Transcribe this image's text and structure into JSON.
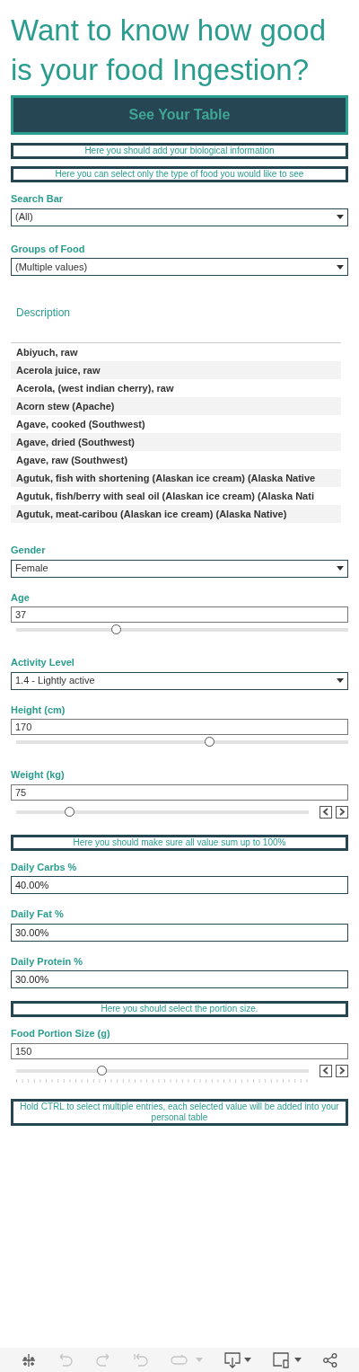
{
  "title": "Want to know how good is your food Ingestion?",
  "table_button": {
    "label": "See Your Table"
  },
  "banner_bio": "Here you should add your biological information",
  "banner_food": "Here you can select only the type of food you would like to see",
  "filters": [
    {
      "label": "Search Bar",
      "value": "(All)"
    },
    {
      "label": "Groups of Food",
      "value": "(Multiple values)"
    }
  ],
  "description_list": {
    "header": "Description",
    "items": [
      {
        "label": "Abiyuch, raw"
      },
      {
        "label": "Acerola juice, raw"
      },
      {
        "label": "Acerola, (west indian cherry), raw"
      },
      {
        "label": "Acorn stew (Apache)"
      },
      {
        "label": "Agave, cooked (Southwest)"
      },
      {
        "label": "Agave, dried (Southwest)"
      },
      {
        "label": "Agave, raw (Southwest)"
      },
      {
        "label": "Agutuk, fish with shortening (Alaskan ice cream) (Alaska Native"
      },
      {
        "label": "Agutuk, fish/berry with seal oil (Alaskan ice cream) (Alaska Nati"
      },
      {
        "label": "Agutuk, meat-caribou (Alaskan ice cream) (Alaska Native)"
      }
    ]
  },
  "bio_fields": [
    {
      "kind": "dropdown",
      "label": "Gender",
      "value": "Female"
    },
    {
      "kind": "slider",
      "label": "Age",
      "value": "37",
      "level": 0.3,
      "steppers": false
    },
    {
      "kind": "dropdown",
      "label": "Activity Level",
      "value": "1.4 - Lightly active"
    },
    {
      "kind": "slider",
      "label": "Height (cm)",
      "value": "170",
      "level": 0.58,
      "steppers": false
    },
    {
      "kind": "slider",
      "label": "Weight (kg)",
      "value": "75",
      "level": 0.18,
      "steppers": true
    }
  ],
  "banner_sum": "Here you should  make sure all value sum up to 100%",
  "macro_fields": [
    {
      "label": "Daily Carbs %",
      "value": "40.00%"
    },
    {
      "label": "Daily Fat %",
      "value": "30.00%"
    },
    {
      "label": "Daily Protein %",
      "value": "30.00%"
    }
  ],
  "banner_portion": "Here you should select the portion size.",
  "portion": {
    "label": "Food Portion Size (g)",
    "value": "150",
    "level": 0.29,
    "steppers": true
  },
  "banner_ctrl": "Hold CTRL to select multiple entries, each selected value will be added into your personal table",
  "toolbar": [
    {
      "kind": "logo",
      "disabled": false
    },
    {
      "kind": "undo",
      "disabled": true
    },
    {
      "kind": "redo",
      "disabled": true
    },
    {
      "kind": "revert",
      "disabled": true
    },
    {
      "kind": "refresh",
      "disabled": true
    },
    {
      "kind": "download",
      "disabled": false
    },
    {
      "kind": "device",
      "disabled": false
    },
    {
      "kind": "share",
      "disabled": false
    }
  ]
}
